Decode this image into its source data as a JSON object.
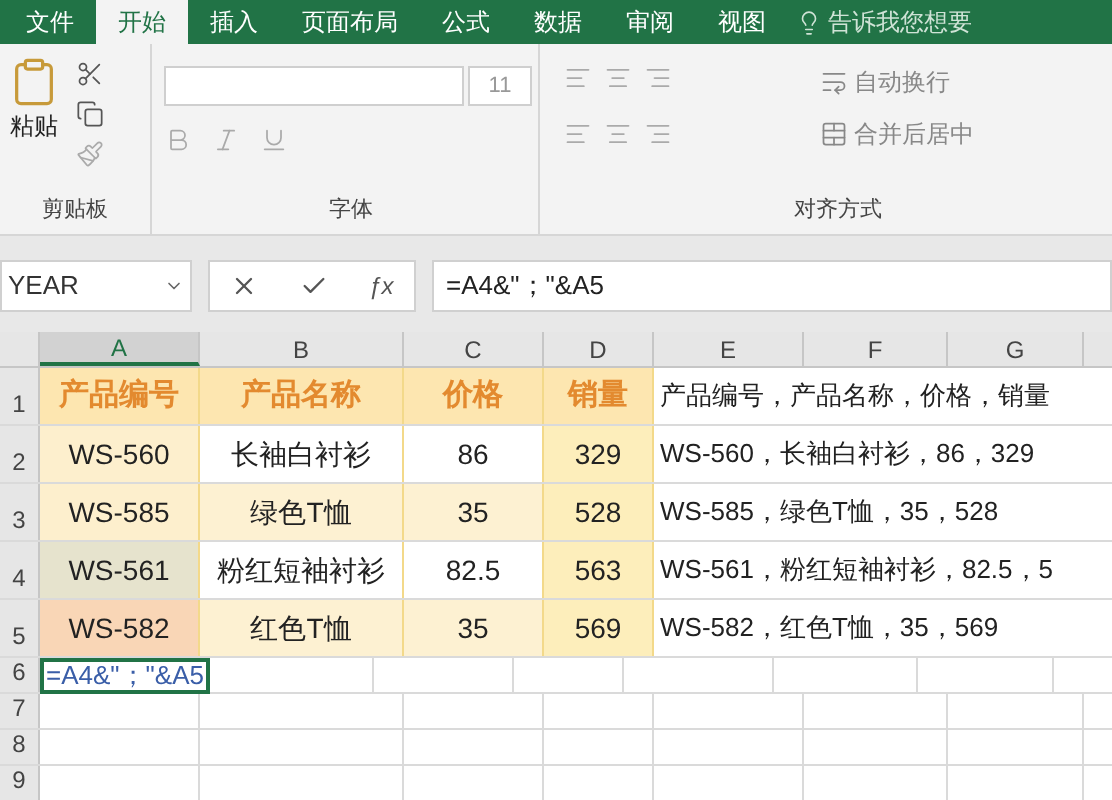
{
  "tabs": [
    {
      "label": "文件",
      "selected": false
    },
    {
      "label": "开始",
      "selected": true
    },
    {
      "label": "插入",
      "selected": false
    },
    {
      "label": "页面布局",
      "selected": false
    },
    {
      "label": "公式",
      "selected": false
    },
    {
      "label": "数据",
      "selected": false
    },
    {
      "label": "审阅",
      "selected": false
    },
    {
      "label": "视图",
      "selected": false
    }
  ],
  "tell_me": "告诉我您想要",
  "ribbon": {
    "paste": "粘贴",
    "clipboard_label": "剪贴板",
    "font_size": "11",
    "font_label": "字体",
    "wrap_text": "自动换行",
    "merge_center": "合并后居中",
    "alignment_label": "对齐方式"
  },
  "name_box": "YEAR",
  "function_symbol": "ƒx",
  "formula": "=A4&\"；\"&A5",
  "columns": [
    {
      "label": "A",
      "selected": true
    },
    {
      "label": "B",
      "selected": false
    },
    {
      "label": "C",
      "selected": false
    },
    {
      "label": "D",
      "selected": false
    },
    {
      "label": "E",
      "selected": false
    },
    {
      "label": "F",
      "selected": false
    },
    {
      "label": "G",
      "selected": false
    }
  ],
  "rows": [
    {
      "number": "1",
      "kind": "header",
      "cells": [
        {
          "text": "产品编号",
          "color": "#fde6b0"
        },
        {
          "text": "产品名称",
          "color": "#fde6b0"
        },
        {
          "text": "价格",
          "color": "#fde6b0"
        },
        {
          "text": "销量",
          "color": "#fde6b0"
        }
      ],
      "result": "产品编号，产品名称，价格，销量"
    },
    {
      "number": "2",
      "kind": "data",
      "cells": [
        {
          "text": "WS-560",
          "color": "#fdefcd"
        },
        {
          "text": "长袖白衬衫",
          "color": "#ffffff"
        },
        {
          "text": "86",
          "color": "#ffffff"
        },
        {
          "text": "329",
          "color": "#fdeebb"
        }
      ],
      "result": "WS-560，长袖白衬衫，86，329"
    },
    {
      "number": "3",
      "kind": "data",
      "cells": [
        {
          "text": "WS-585",
          "color": "#fdefcd"
        },
        {
          "text": "绿色T恤",
          "color": "#fdf1d2"
        },
        {
          "text": "35",
          "color": "#fdf1d2"
        },
        {
          "text": "528",
          "color": "#fdeebb"
        }
      ],
      "result": "WS-585，绿色T恤，35，528"
    },
    {
      "number": "4",
      "kind": "data",
      "cells": [
        {
          "text": "WS-561",
          "color": "#e6e3cd"
        },
        {
          "text": "粉红短袖衬衫",
          "color": "#ffffff"
        },
        {
          "text": "82.5",
          "color": "#ffffff"
        },
        {
          "text": "563",
          "color": "#fdeebb"
        }
      ],
      "result": "WS-561，粉红短袖衬衫，82.5，5"
    },
    {
      "number": "5",
      "kind": "data",
      "cells": [
        {
          "text": "WS-582",
          "color": "#f9d6b6"
        },
        {
          "text": "红色T恤",
          "color": "#fdf1d2"
        },
        {
          "text": "35",
          "color": "#fdf1d2"
        },
        {
          "text": "569",
          "color": "#fdeebb"
        }
      ],
      "result": "WS-582，红色T恤，35，569"
    },
    {
      "number": "6",
      "kind": "editing",
      "edit": "=A4&\"；\"&A5"
    },
    {
      "number": "7",
      "kind": "empty"
    },
    {
      "number": "8",
      "kind": "empty"
    },
    {
      "number": "9",
      "kind": "empty"
    }
  ]
}
